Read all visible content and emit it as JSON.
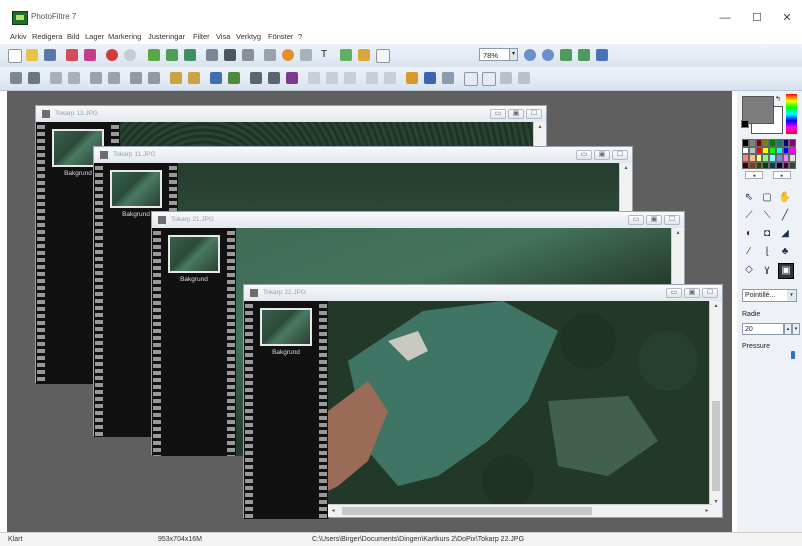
{
  "app": {
    "title": "PhotoFiltre 7"
  },
  "window_controls": {
    "minimize": "—",
    "maximize": "☐",
    "close": "✕"
  },
  "menu": [
    "Arkiv",
    "Redigera",
    "Bild",
    "Lager",
    "Markering",
    "Justeringar",
    "Filter",
    "Visa",
    "Verktyg",
    "Fönster",
    "?"
  ],
  "toolbar": {
    "zoom_value": "78%"
  },
  "documents": [
    {
      "name": "Tokarp 13.JPG",
      "layer_label": "Bakgrund"
    },
    {
      "name": "Tokarp 11.JPG",
      "layer_label": "Bakgrund"
    },
    {
      "name": "Tokarp 21.JPG",
      "layer_label": "Bakgrund"
    },
    {
      "name": "Tokarp 22.JPG",
      "layer_label": "Bakgrund"
    }
  ],
  "right_panel": {
    "brush_style": "Pointillé...",
    "radius_label": "Radie",
    "radius_value": "20",
    "pressure_label": "Pressure"
  },
  "statusbar": {
    "state": "Klart",
    "image_info": "953x704x16M",
    "path": "C:\\Users\\Birger\\Documents\\Dingen\\Kartkurs 2\\DoPix\\Tokarp 22.JPG"
  },
  "colors": {
    "workspace": "#5f5f5f",
    "toolbar": "#dde6f0",
    "accent": "#2f6fd0"
  }
}
